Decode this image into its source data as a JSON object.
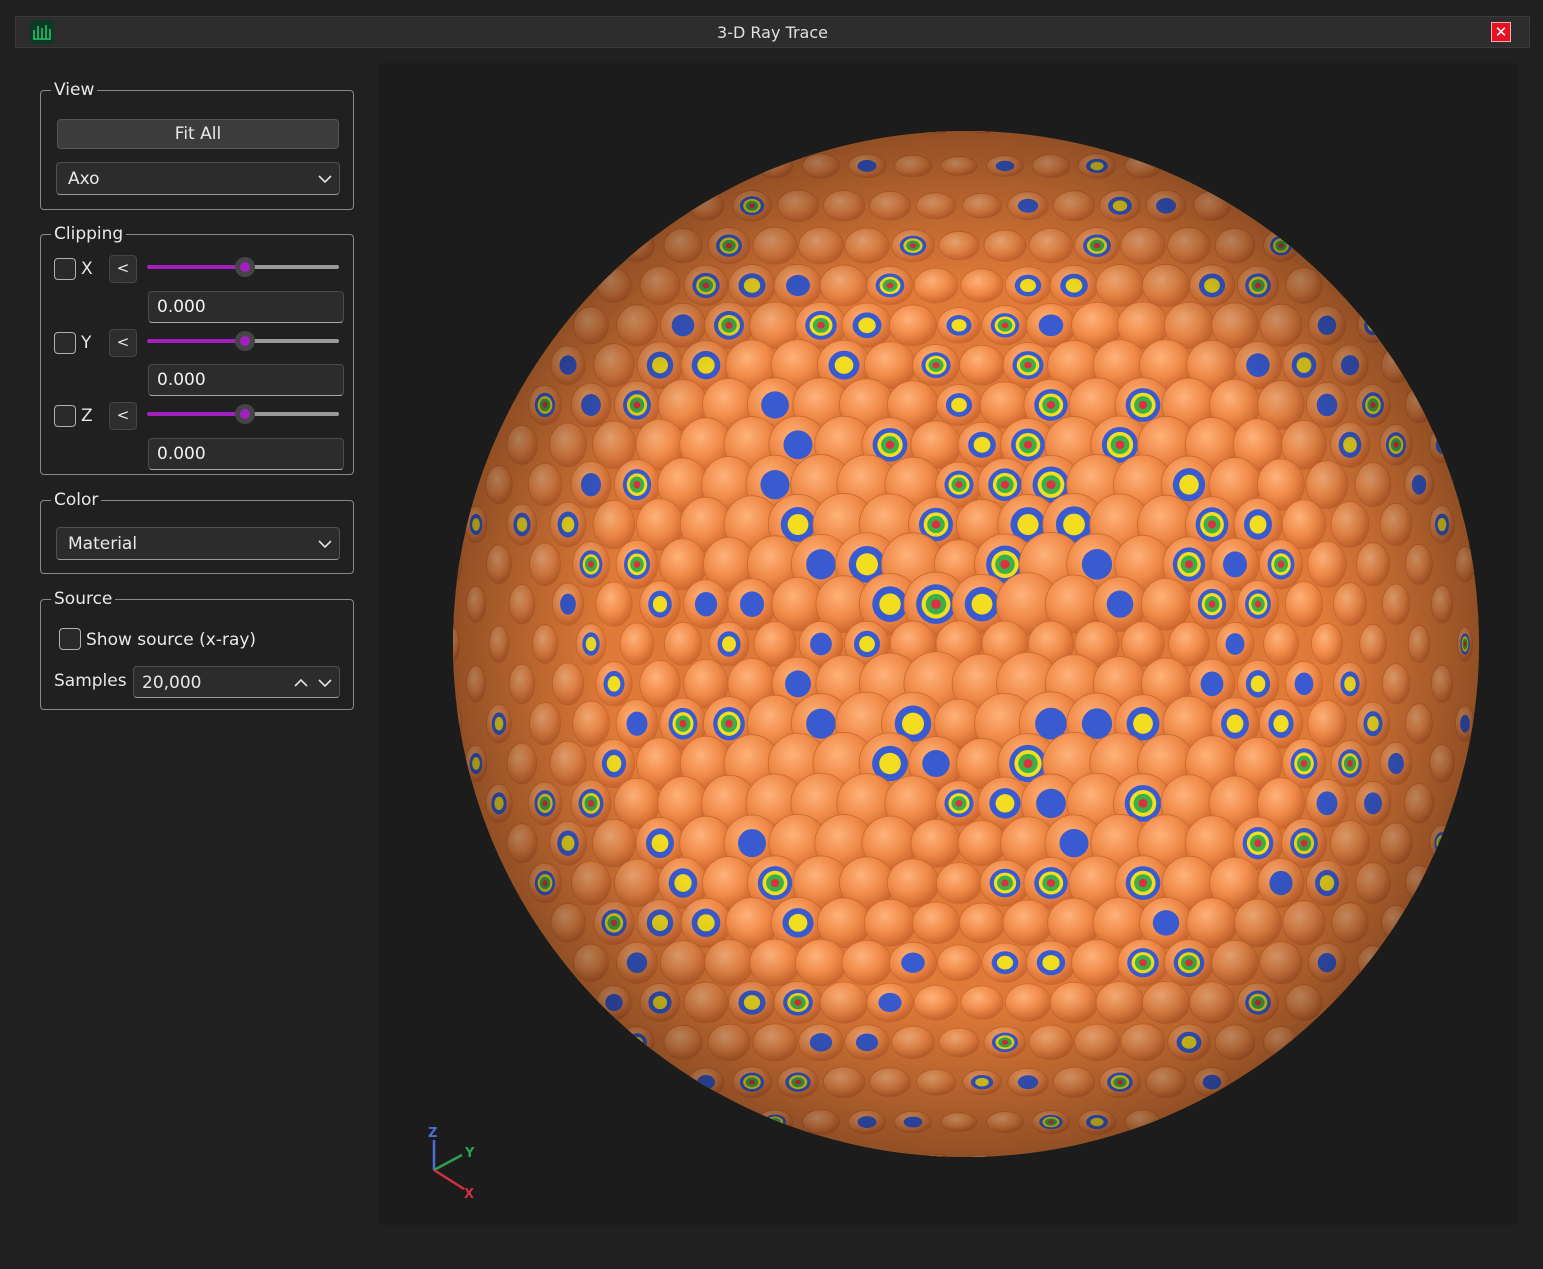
{
  "window": {
    "title": "3-D Ray Trace",
    "close_icon": "close-icon",
    "logo_icon": "app-logo-icon"
  },
  "view_group": {
    "legend": "View",
    "fit_all_label": "Fit All",
    "projection_value": "Axo"
  },
  "clipping_group": {
    "legend": "Clipping",
    "axes": [
      {
        "label": "X",
        "direction_label": "<",
        "value": "0.000",
        "slider_fraction": 0.5,
        "enabled": false
      },
      {
        "label": "Y",
        "direction_label": "<",
        "value": "0.000",
        "slider_fraction": 0.5,
        "enabled": false
      },
      {
        "label": "Z",
        "direction_label": "<",
        "value": "0.000",
        "slider_fraction": 0.5,
        "enabled": false
      }
    ]
  },
  "color_group": {
    "legend": "Color",
    "mode_value": "Material"
  },
  "source_group": {
    "legend": "Source",
    "show_source_label": "Show source (x-ray)",
    "show_source_checked": false,
    "samples_label": "Samples",
    "samples_value": "20,000"
  },
  "viewport": {
    "object": "sphere-of-cells",
    "colors": {
      "shell": "#f08a48",
      "blue": "#3a5bd0",
      "yellow": "#f2dd20",
      "green": "#3cb048",
      "red": "#e03040",
      "background": "#1c1c1c",
      "accent": "#a020c0"
    },
    "triad": {
      "z_label": "Z",
      "y_label": "Y",
      "x_label": "X"
    }
  }
}
